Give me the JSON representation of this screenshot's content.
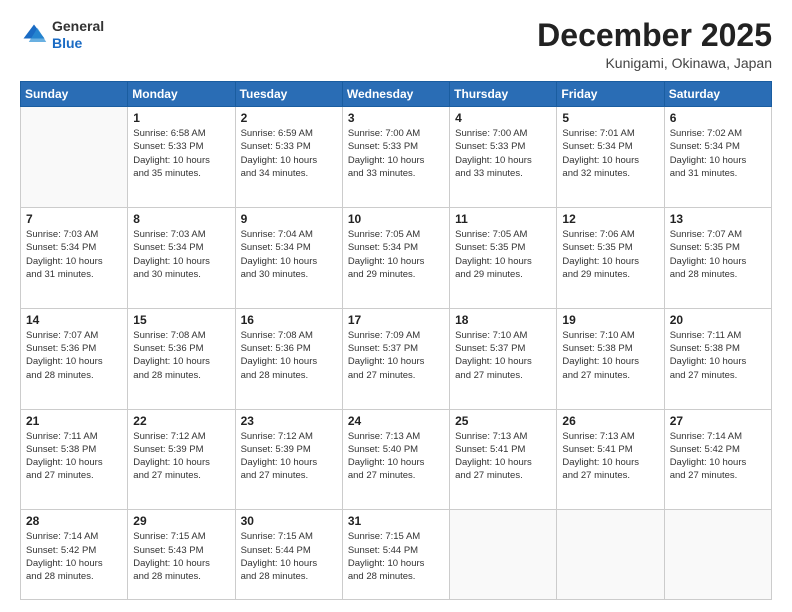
{
  "header": {
    "logo_general": "General",
    "logo_blue": "Blue",
    "month_title": "December 2025",
    "location": "Kunigami, Okinawa, Japan"
  },
  "days_of_week": [
    "Sunday",
    "Monday",
    "Tuesday",
    "Wednesday",
    "Thursday",
    "Friday",
    "Saturday"
  ],
  "weeks": [
    [
      {
        "day": "",
        "info": ""
      },
      {
        "day": "1",
        "info": "Sunrise: 6:58 AM\nSunset: 5:33 PM\nDaylight: 10 hours\nand 35 minutes."
      },
      {
        "day": "2",
        "info": "Sunrise: 6:59 AM\nSunset: 5:33 PM\nDaylight: 10 hours\nand 34 minutes."
      },
      {
        "day": "3",
        "info": "Sunrise: 7:00 AM\nSunset: 5:33 PM\nDaylight: 10 hours\nand 33 minutes."
      },
      {
        "day": "4",
        "info": "Sunrise: 7:00 AM\nSunset: 5:33 PM\nDaylight: 10 hours\nand 33 minutes."
      },
      {
        "day": "5",
        "info": "Sunrise: 7:01 AM\nSunset: 5:34 PM\nDaylight: 10 hours\nand 32 minutes."
      },
      {
        "day": "6",
        "info": "Sunrise: 7:02 AM\nSunset: 5:34 PM\nDaylight: 10 hours\nand 31 minutes."
      }
    ],
    [
      {
        "day": "7",
        "info": "Sunrise: 7:03 AM\nSunset: 5:34 PM\nDaylight: 10 hours\nand 31 minutes."
      },
      {
        "day": "8",
        "info": "Sunrise: 7:03 AM\nSunset: 5:34 PM\nDaylight: 10 hours\nand 30 minutes."
      },
      {
        "day": "9",
        "info": "Sunrise: 7:04 AM\nSunset: 5:34 PM\nDaylight: 10 hours\nand 30 minutes."
      },
      {
        "day": "10",
        "info": "Sunrise: 7:05 AM\nSunset: 5:34 PM\nDaylight: 10 hours\nand 29 minutes."
      },
      {
        "day": "11",
        "info": "Sunrise: 7:05 AM\nSunset: 5:35 PM\nDaylight: 10 hours\nand 29 minutes."
      },
      {
        "day": "12",
        "info": "Sunrise: 7:06 AM\nSunset: 5:35 PM\nDaylight: 10 hours\nand 29 minutes."
      },
      {
        "day": "13",
        "info": "Sunrise: 7:07 AM\nSunset: 5:35 PM\nDaylight: 10 hours\nand 28 minutes."
      }
    ],
    [
      {
        "day": "14",
        "info": "Sunrise: 7:07 AM\nSunset: 5:36 PM\nDaylight: 10 hours\nand 28 minutes."
      },
      {
        "day": "15",
        "info": "Sunrise: 7:08 AM\nSunset: 5:36 PM\nDaylight: 10 hours\nand 28 minutes."
      },
      {
        "day": "16",
        "info": "Sunrise: 7:08 AM\nSunset: 5:36 PM\nDaylight: 10 hours\nand 28 minutes."
      },
      {
        "day": "17",
        "info": "Sunrise: 7:09 AM\nSunset: 5:37 PM\nDaylight: 10 hours\nand 27 minutes."
      },
      {
        "day": "18",
        "info": "Sunrise: 7:10 AM\nSunset: 5:37 PM\nDaylight: 10 hours\nand 27 minutes."
      },
      {
        "day": "19",
        "info": "Sunrise: 7:10 AM\nSunset: 5:38 PM\nDaylight: 10 hours\nand 27 minutes."
      },
      {
        "day": "20",
        "info": "Sunrise: 7:11 AM\nSunset: 5:38 PM\nDaylight: 10 hours\nand 27 minutes."
      }
    ],
    [
      {
        "day": "21",
        "info": "Sunrise: 7:11 AM\nSunset: 5:38 PM\nDaylight: 10 hours\nand 27 minutes."
      },
      {
        "day": "22",
        "info": "Sunrise: 7:12 AM\nSunset: 5:39 PM\nDaylight: 10 hours\nand 27 minutes."
      },
      {
        "day": "23",
        "info": "Sunrise: 7:12 AM\nSunset: 5:39 PM\nDaylight: 10 hours\nand 27 minutes."
      },
      {
        "day": "24",
        "info": "Sunrise: 7:13 AM\nSunset: 5:40 PM\nDaylight: 10 hours\nand 27 minutes."
      },
      {
        "day": "25",
        "info": "Sunrise: 7:13 AM\nSunset: 5:41 PM\nDaylight: 10 hours\nand 27 minutes."
      },
      {
        "day": "26",
        "info": "Sunrise: 7:13 AM\nSunset: 5:41 PM\nDaylight: 10 hours\nand 27 minutes."
      },
      {
        "day": "27",
        "info": "Sunrise: 7:14 AM\nSunset: 5:42 PM\nDaylight: 10 hours\nand 27 minutes."
      }
    ],
    [
      {
        "day": "28",
        "info": "Sunrise: 7:14 AM\nSunset: 5:42 PM\nDaylight: 10 hours\nand 28 minutes."
      },
      {
        "day": "29",
        "info": "Sunrise: 7:15 AM\nSunset: 5:43 PM\nDaylight: 10 hours\nand 28 minutes."
      },
      {
        "day": "30",
        "info": "Sunrise: 7:15 AM\nSunset: 5:44 PM\nDaylight: 10 hours\nand 28 minutes."
      },
      {
        "day": "31",
        "info": "Sunrise: 7:15 AM\nSunset: 5:44 PM\nDaylight: 10 hours\nand 28 minutes."
      },
      {
        "day": "",
        "info": ""
      },
      {
        "day": "",
        "info": ""
      },
      {
        "day": "",
        "info": ""
      }
    ]
  ]
}
